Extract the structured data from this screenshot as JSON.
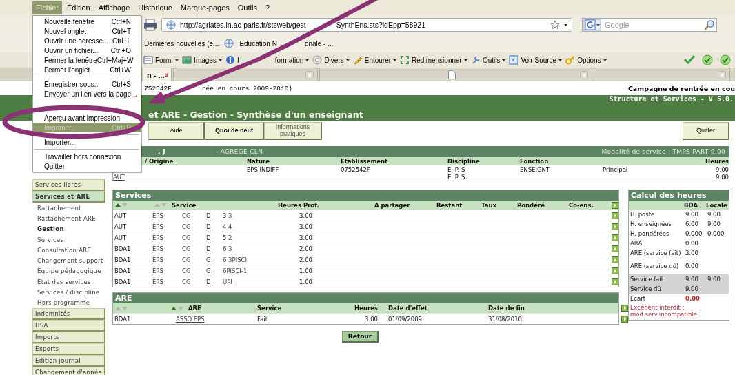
{
  "menubar": [
    {
      "label": "Fichier",
      "selected": true
    },
    {
      "label": "Édition",
      "selected": false
    },
    {
      "label": "Affichage",
      "selected": false
    },
    {
      "label": "Historique",
      "selected": false
    },
    {
      "label": "Marque-pages",
      "selected": false
    },
    {
      "label": "Outils",
      "selected": false
    },
    {
      "label": "?",
      "selected": false
    }
  ],
  "file_menu": {
    "groups": [
      [
        {
          "label": "Nouvelle fenêtre",
          "shortcut": "Ctrl+N",
          "selected": false,
          "disabled": false
        },
        {
          "label": "Nouvel onglet",
          "shortcut": "Ctrl+T",
          "selected": false,
          "disabled": false
        },
        {
          "label": "Ouvrir une adresse...",
          "shortcut": "Ctrl+L",
          "selected": false,
          "disabled": false
        },
        {
          "label": "Ouvrir un fichier...",
          "shortcut": "Ctrl+O",
          "selected": false,
          "disabled": false
        },
        {
          "label": "Fermer la fenêtre",
          "shortcut": "Ctrl+Maj+W",
          "selected": false,
          "disabled": false
        },
        {
          "label": "Fermer l'onglet",
          "shortcut": "Ctrl+W",
          "selected": false,
          "disabled": false
        }
      ],
      [
        {
          "label": "Enregistrer sous...",
          "shortcut": "Ctrl+S",
          "selected": false,
          "disabled": false
        },
        {
          "label": "Envoyer un lien vers la page...",
          "selected": false,
          "disabled": false
        }
      ],
      [
        {
          "selected": false
        },
        {
          "label": "Aperçu avant impression",
          "selected": false,
          "disabled": false
        },
        {
          "label": "Imprimer...",
          "shortcut": "Ctrl+P",
          "selected": true,
          "disabled": true
        }
      ],
      [
        {
          "label": "Importer...",
          "selected": false,
          "disabled": false
        }
      ],
      [
        {
          "label": "Travailler hors connexion",
          "selected": false,
          "disabled": false
        },
        {
          "label": "Quitter",
          "selected": false,
          "disabled": false
        }
      ]
    ]
  },
  "address_bar": {
    "url": [
      "http://agriates.in.ac-paris.fr/stsweb/gest",
      "SynthEns.sts?idEpp=58921"
    ]
  },
  "search": {
    "placeholder": "Google"
  },
  "bookmarks": [
    "Dernières nouvelles (e...",
    [
      "Education N",
      "onale - ..."
    ]
  ],
  "dev_toolbar": [
    "Form.",
    "Images",
    [
      "I",
      "formation"
    ],
    "Divers",
    "Entourer",
    "Redimensionner",
    "Outils",
    "Voir Source",
    "Options"
  ],
  "tabs": [
    {
      "label": "n - ...",
      "selected": true
    },
    {
      "selected": false
    },
    {
      "selected": false
    },
    {
      "selected": false
    }
  ],
  "page_header": {
    "year_info": [
      "752542F",
      "née en cours 2009-2010)"
    ],
    "campaign": "Campagne de rentrée en cou"
  },
  "banner": {
    "title": "et ARE - Gestion - Synthèse d'un enseignant",
    "version": "Structure et Services - V 5.0."
  },
  "nav_buttons": [
    "Aide",
    "Quoi de neuf",
    "Informations pratiques"
  ],
  "quit_button": "Quitter",
  "sidebar": {
    "items": [
      {
        "label": "Services libres",
        "kind": "section",
        "selected": false
      },
      {
        "label": "Services et ARE",
        "kind": "section",
        "selected": true
      },
      {
        "label": "Rattachement",
        "kind": "sub",
        "selected": false
      },
      {
        "label": "Rattachement ARE",
        "kind": "sub",
        "selected": false
      },
      {
        "label": "Gestion",
        "kind": "sub",
        "selected": true
      },
      {
        "label": "Services",
        "kind": "sub",
        "selected": false
      },
      {
        "label": "Consultation ARE",
        "kind": "sub",
        "selected": false
      },
      {
        "label": "Changement support",
        "kind": "sub",
        "selected": false
      },
      {
        "label": "Equipe pédagogique",
        "kind": "sub",
        "selected": false
      },
      {
        "label": "Etat des services",
        "kind": "sub",
        "selected": false
      },
      {
        "label": "Services / discipline",
        "kind": "sub",
        "selected": false
      },
      {
        "label": "Hors programme",
        "kind": "sub",
        "selected": false
      },
      {
        "label": "Indemnités",
        "kind": "section",
        "selected": false
      },
      {
        "label": "HSA",
        "kind": "section",
        "selected": false
      },
      {
        "label": "Imports",
        "kind": "section",
        "selected": false
      },
      {
        "label": "Exports",
        "kind": "section",
        "selected": false
      },
      {
        "label": "Edition journal",
        "kind": "section",
        "selected": false
      },
      {
        "label": "Changement d'année",
        "kind": "section",
        "selected": false
      }
    ]
  },
  "teacher": {
    "name": ", J",
    "grade": "- AGREGE CLN",
    "modality": "Modalité  de service : TMPS PART  9.00",
    "columns": [
      "/ Origine",
      "Nature",
      "Etablissement",
      "Discipline",
      "Fonction",
      null,
      "Heures"
    ],
    "rows": [
      [
        null,
        "EPS INDIFF",
        "0752542F",
        "E. P. S",
        "ENSEIGNT",
        "Principal",
        "9.00"
      ],
      [
        "AUT",
        null,
        null,
        "E. P. S",
        null,
        null,
        "9.00"
      ]
    ]
  },
  "services": {
    "title": "Services",
    "sort_keys": [
      {
        "active": true
      },
      {
        "active": false
      }
    ],
    "columns": [
      "Service",
      "Heures Prof.",
      "A partager",
      "Restant",
      "Taux",
      "Pondéré",
      "Co-ens."
    ],
    "rows": [
      {
        "origin": "AUT",
        "subject": "EPS",
        "type": "CG",
        "mode": "D",
        "group": "3 3",
        "hours": "3.00"
      },
      {
        "origin": "AUT",
        "subject": "EPS",
        "type": "CG",
        "mode": "D",
        "group": "4 4",
        "hours": "3.00"
      },
      {
        "origin": "AUT",
        "subject": "EPS",
        "type": "CG",
        "mode": "D",
        "group": "5 2",
        "hours": "3.00"
      },
      {
        "origin": "BDA1",
        "subject": "EPS",
        "type": "CG",
        "mode": "D",
        "group": "6 3",
        "hours": "2.00"
      },
      {
        "origin": "BDA1",
        "subject": "EPS",
        "type": "CG",
        "mode": "G",
        "group": "6 3PISCI",
        "hours": "2.00"
      },
      {
        "origin": "BDA1",
        "subject": "EPS",
        "type": "CG",
        "mode": "G",
        "group": "6PISCI-1",
        "hours": "1.00"
      },
      {
        "origin": "BDA1",
        "subject": "EPS",
        "type": "CG",
        "mode": "D",
        "group": "UPI",
        "hours": "1.00"
      }
    ]
  },
  "are": {
    "title": "ARE",
    "sort_keys": [
      {
        "active": false
      },
      {
        "active": true
      }
    ],
    "columns": [
      "ARE",
      "Service",
      "Heures",
      "Date d'effet",
      "Date de fin"
    ],
    "rows": [
      {
        "origin": "BDA1",
        "are": "ASSO.EPS",
        "service": "Fait",
        "hours": "3.00",
        "start": "01/09/2009",
        "end": "31/08/2010"
      }
    ]
  },
  "retour_button": "Retour",
  "calc": {
    "title": "Calcul des heures",
    "columns": [
      "BDA",
      "Locale"
    ],
    "rows": [
      {
        "label": "H. poste",
        "bda": "9.00",
        "locale": "9.00",
        "kind": "plain"
      },
      {
        "label": "H. enseignées",
        "bda": "6.00",
        "locale": "9.00",
        "kind": "plain"
      },
      {
        "label": "H. pondérées",
        "bda": "0.000",
        "locale": "0.000",
        "kind": "plain"
      },
      {
        "label": "ARA",
        "bda": "0.00",
        "kind": "plain"
      },
      {
        "label": "ARE (service fait)",
        "bda": "3.00",
        "kind": "plain"
      },
      {
        "label": "ARE (service dû)",
        "bda": "0.00",
        "kind": "tall"
      },
      {
        "label": "Service fait",
        "bda": "9.00",
        "locale": "9.00",
        "kind": "shaded"
      },
      {
        "label": "Service dû",
        "bda": "9.00",
        "kind": "shaded"
      },
      {
        "label": "Ecart",
        "bda": "0.00",
        "kind": "alert"
      }
    ],
    "message": "Excédent interdit : mod.serv.incompatible"
  }
}
